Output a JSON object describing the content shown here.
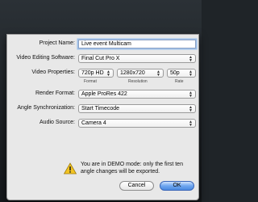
{
  "dialog": {
    "project_name": {
      "label": "Project Name:",
      "value": "Live event Multicam"
    },
    "video_editing_software": {
      "label": "Video Editing Software:",
      "value": "Final Cut Pro X"
    },
    "video_properties": {
      "label": "Video Properties:",
      "format": {
        "value": "720p HD",
        "caption": "Format"
      },
      "resolution": {
        "value": "1280x720",
        "caption": "Resolution"
      },
      "rate": {
        "value": "50p",
        "caption": "Rate"
      }
    },
    "render_format": {
      "label": "Render Format:",
      "value": "Apple ProRes 422"
    },
    "angle_synchronization": {
      "label": "Angle Synchronization:",
      "value": "Start Timecode"
    },
    "audio_source": {
      "label": "Audio Source:",
      "value": "Camera 4"
    },
    "demo_warning": "You are in DEMO mode: only the first ten angle changes will be exported.",
    "cancel_label": "Cancel",
    "ok_label": "OK"
  },
  "colors": {
    "ok_button": "#4a89e0",
    "focus_ring": "#9cc0ea",
    "sheet_bg": "#e8e8e8"
  },
  "icons": [
    "warning-icon",
    "popup-arrows-icon"
  ]
}
